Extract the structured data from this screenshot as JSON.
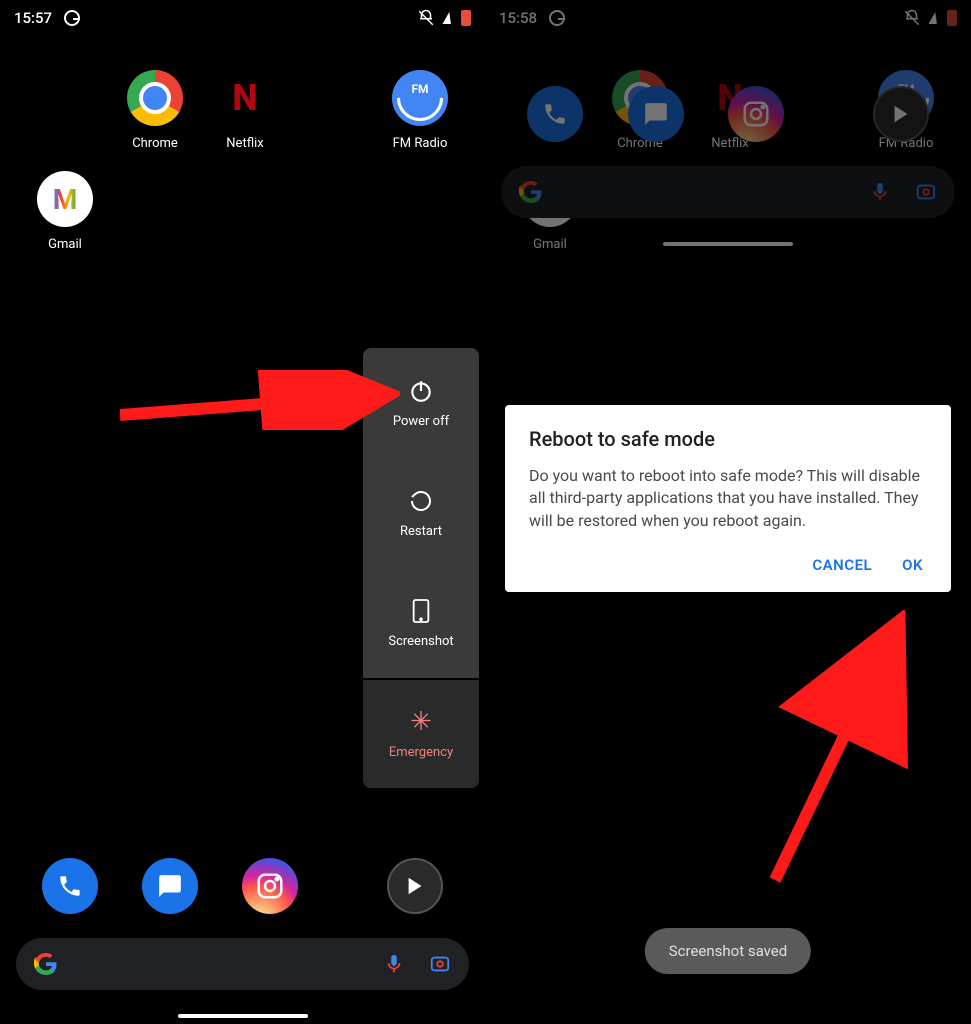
{
  "left": {
    "status": {
      "time": "15:57"
    },
    "apps": {
      "chrome": "Chrome",
      "netflix": "Netflix",
      "fmradio": "FM Radio",
      "gmail": "Gmail"
    },
    "power_menu": {
      "power_off": "Power off",
      "restart": "Restart",
      "screenshot": "Screenshot",
      "emergency": "Emergency"
    }
  },
  "right": {
    "status": {
      "time": "15:58"
    },
    "apps": {
      "chrome": "Chrome",
      "netflix": "Netflix",
      "fmradio": "FM Radio",
      "gmail": "Gmail"
    },
    "dialog": {
      "title": "Reboot to safe mode",
      "body": "Do you want to reboot into safe mode? This will disable all third-party applications that you have installed. They will be restored when you reboot again.",
      "cancel": "CANCEL",
      "ok": "OK"
    },
    "toast": "Screenshot saved"
  }
}
